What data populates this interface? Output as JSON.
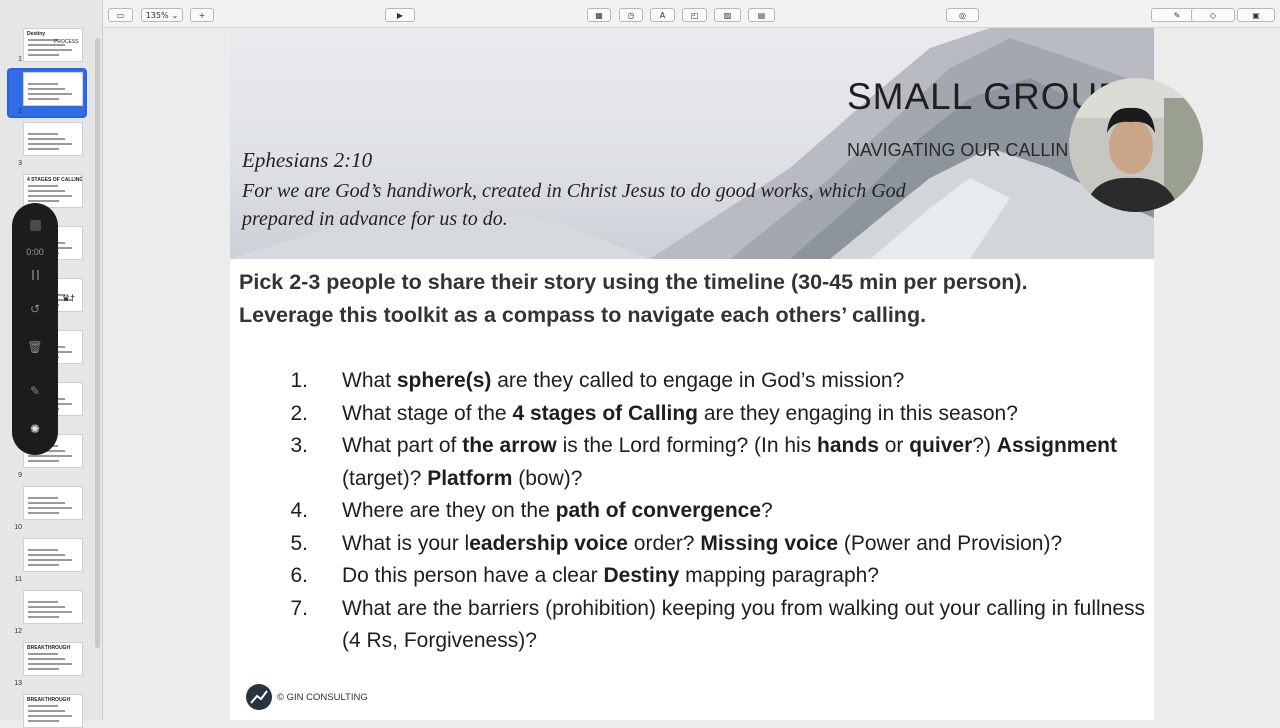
{
  "toolbar": {
    "zoom": "135%",
    "play_icon": "play-icon",
    "icons": [
      "sidebar-toggle-icon",
      "add-slide-icon",
      "table-icon",
      "chart-icon",
      "text-box-icon",
      "shape-icon",
      "media-icon",
      "comment-icon",
      "collaborate-icon",
      "format-icon",
      "animate-icon",
      "document-icon"
    ]
  },
  "sidebar": {
    "slides": [
      {
        "number": "1",
        "title": "Destiny",
        "subtitle": "PROCESS"
      },
      {
        "number": "2"
      },
      {
        "number": "3"
      },
      {
        "number": "",
        "title": "4 STAGES OF CALLING"
      },
      {
        "number": ""
      },
      {
        "number": "",
        "glyph": "♛†"
      },
      {
        "number": ""
      },
      {
        "number": "",
        "title": "GRAPHIC"
      },
      {
        "number": "9"
      },
      {
        "number": "10"
      },
      {
        "number": "11"
      },
      {
        "number": "12"
      },
      {
        "number": "13",
        "title": "BREAKTHROUGH"
      },
      {
        "number": "",
        "title": "BREAKTHROUGH"
      }
    ]
  },
  "recorder": {
    "timer": "0:00"
  },
  "slide": {
    "banner": {
      "title": "SMALL GROUP",
      "subtitle": "NAVIGATING OUR CALLING",
      "verse_ref": "Ephesians 2:10",
      "verse_text": "For we are God’s handiwork, created in Christ Jesus to do good works, which God prepared in advance for us to do."
    },
    "instruction_line1": "Pick 2-3 people to share their story using the timeline (30-45 min per person).",
    "instruction_line2": "Leverage this toolkit as a compass to navigate each others’ calling.",
    "questions": [
      {
        "num": "1.",
        "parts": [
          [
            "What ",
            false
          ],
          [
            "sphere(s)",
            true
          ],
          [
            " are they called to engage in God’s mission?",
            false
          ]
        ]
      },
      {
        "num": "2.",
        "parts": [
          [
            "What stage of the ",
            false
          ],
          [
            "4 stages of Calling",
            true
          ],
          [
            " are they engaging in this season?",
            false
          ]
        ]
      },
      {
        "num": "3.",
        "parts": [
          [
            "What part of ",
            false
          ],
          [
            "the arrow",
            true
          ],
          [
            " is the Lord forming? (In his ",
            false
          ],
          [
            "hands",
            true
          ],
          [
            " or ",
            false
          ],
          [
            "quiver",
            true
          ],
          [
            "?) ",
            false
          ],
          [
            "Assignment",
            true
          ],
          [
            " (target)? ",
            false
          ],
          [
            "Platform",
            true
          ],
          [
            " (bow)?",
            false
          ]
        ]
      },
      {
        "num": "4.",
        "parts": [
          [
            "Where are they on the ",
            false
          ],
          [
            "path of convergence",
            true
          ],
          [
            "?",
            false
          ]
        ]
      },
      {
        "num": "5.",
        "parts": [
          [
            "What is your l",
            false
          ],
          [
            "eadership voice",
            true
          ],
          [
            " order? ",
            false
          ],
          [
            "Missing voice",
            true
          ],
          [
            " (Power and Provision)?",
            false
          ]
        ]
      },
      {
        "num": "6.",
        "parts": [
          [
            "Do this person have a clear ",
            false
          ],
          [
            "Destiny",
            true
          ],
          [
            " mapping paragraph?",
            false
          ]
        ]
      },
      {
        "num": "7.",
        "parts": [
          [
            "What are the barriers (prohibition) keeping you from walking out your calling in fullness (4 Rs, Forgiveness)?",
            false
          ]
        ]
      }
    ],
    "footer": "© GIN CONSULTING"
  },
  "colors": {
    "accent": "#2563eb",
    "recorder_bg": "#1c1c1c"
  }
}
